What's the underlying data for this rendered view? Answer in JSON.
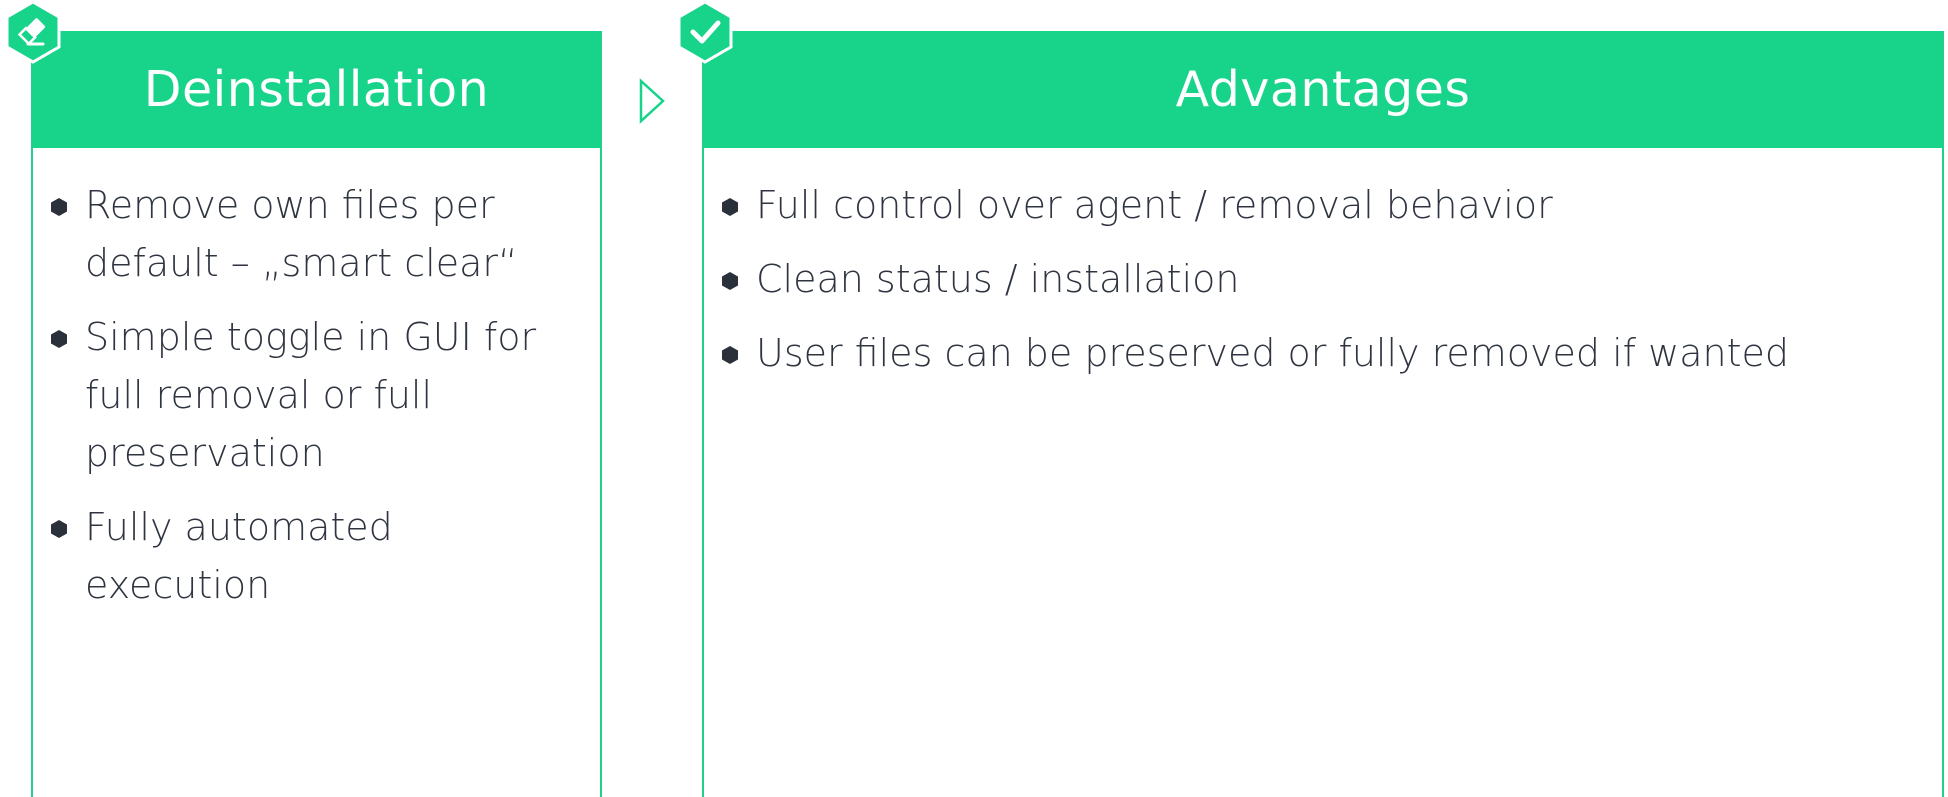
{
  "left_panel": {
    "title": "Deinstallation",
    "icon": "eraser-icon",
    "items": [
      "Remove own files per default – „smart clear“",
      "Simple toggle in GUI for full removal or full preservation",
      "Fully automated execution"
    ]
  },
  "right_panel": {
    "title": "Advantages",
    "icon": "checkmark-icon",
    "items": [
      "Full control over agent / removal behavior",
      "Clean status / installation",
      "User files can be preserved or fully removed if wanted"
    ]
  },
  "colors": {
    "accent": "#17d48a",
    "text": "#2b313b",
    "header_text": "#ffffff"
  }
}
